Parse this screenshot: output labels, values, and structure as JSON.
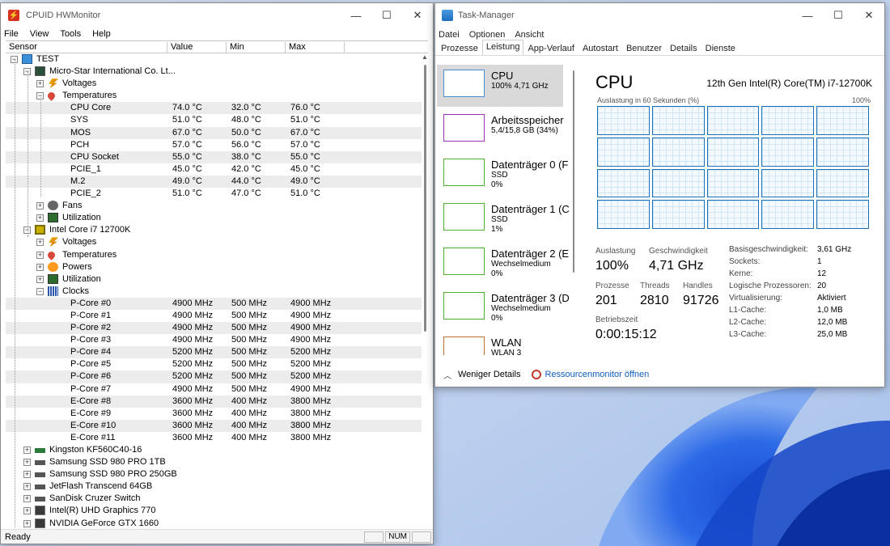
{
  "hwmonitor": {
    "title": "CPUID HWMonitor",
    "app_icon": "lightning-icon",
    "menu": [
      "File",
      "View",
      "Tools",
      "Help"
    ],
    "columns": [
      "Sensor",
      "Value",
      "Min",
      "Max"
    ],
    "tree": [
      {
        "label": "TEST",
        "level": 0,
        "icon": "pc",
        "exp": "-"
      },
      {
        "label": "Micro-Star International Co. Lt...",
        "level": 1,
        "icon": "mb",
        "exp": "-"
      },
      {
        "label": "Voltages",
        "level": 2,
        "icon": "volt",
        "exp": "+"
      },
      {
        "label": "Temperatures",
        "level": 2,
        "icon": "temp",
        "exp": "-"
      },
      {
        "label": "CPU Core",
        "level": 3,
        "value": "74.0 °C",
        "min": "32.0 °C",
        "max": "76.0 °C"
      },
      {
        "label": "SYS",
        "level": 3,
        "value": "51.0 °C",
        "min": "48.0 °C",
        "max": "51.0 °C"
      },
      {
        "label": "MOS",
        "level": 3,
        "value": "67.0 °C",
        "min": "50.0 °C",
        "max": "67.0 °C"
      },
      {
        "label": "PCH",
        "level": 3,
        "value": "57.0 °C",
        "min": "56.0 °C",
        "max": "57.0 °C"
      },
      {
        "label": "CPU Socket",
        "level": 3,
        "value": "55.0 °C",
        "min": "38.0 °C",
        "max": "55.0 °C"
      },
      {
        "label": "PCIE_1",
        "level": 3,
        "value": "45.0 °C",
        "min": "42.0 °C",
        "max": "45.0 °C"
      },
      {
        "label": "M.2",
        "level": 3,
        "value": "49.0 °C",
        "min": "44.0 °C",
        "max": "49.0 °C"
      },
      {
        "label": "PCIE_2",
        "level": 3,
        "value": "51.0 °C",
        "min": "47.0 °C",
        "max": "51.0 °C"
      },
      {
        "label": "Fans",
        "level": 2,
        "icon": "fan",
        "exp": "+"
      },
      {
        "label": "Utilization",
        "level": 2,
        "icon": "util",
        "exp": "+"
      },
      {
        "label": "Intel Core i7 12700K",
        "level": 1,
        "icon": "cpu",
        "exp": "-"
      },
      {
        "label": "Voltages",
        "level": 2,
        "icon": "volt",
        "exp": "+"
      },
      {
        "label": "Temperatures",
        "level": 2,
        "icon": "temp",
        "exp": "+"
      },
      {
        "label": "Powers",
        "level": 2,
        "icon": "power",
        "exp": "+"
      },
      {
        "label": "Utilization",
        "level": 2,
        "icon": "util",
        "exp": "+"
      },
      {
        "label": "Clocks",
        "level": 2,
        "icon": "clock",
        "exp": "-"
      },
      {
        "label": "P-Core #0",
        "level": 3,
        "value": "4900 MHz",
        "min": "500 MHz",
        "max": "4900 MHz"
      },
      {
        "label": "P-Core #1",
        "level": 3,
        "value": "4900 MHz",
        "min": "500 MHz",
        "max": "4900 MHz"
      },
      {
        "label": "P-Core #2",
        "level": 3,
        "value": "4900 MHz",
        "min": "500 MHz",
        "max": "4900 MHz"
      },
      {
        "label": "P-Core #3",
        "level": 3,
        "value": "4900 MHz",
        "min": "500 MHz",
        "max": "4900 MHz"
      },
      {
        "label": "P-Core #4",
        "level": 3,
        "value": "5200 MHz",
        "min": "500 MHz",
        "max": "5200 MHz"
      },
      {
        "label": "P-Core #5",
        "level": 3,
        "value": "5200 MHz",
        "min": "500 MHz",
        "max": "5200 MHz"
      },
      {
        "label": "P-Core #6",
        "level": 3,
        "value": "5200 MHz",
        "min": "500 MHz",
        "max": "5200 MHz"
      },
      {
        "label": "P-Core #7",
        "level": 3,
        "value": "4900 MHz",
        "min": "500 MHz",
        "max": "4900 MHz"
      },
      {
        "label": "E-Core #8",
        "level": 3,
        "value": "3600 MHz",
        "min": "400 MHz",
        "max": "3800 MHz"
      },
      {
        "label": "E-Core #9",
        "level": 3,
        "value": "3600 MHz",
        "min": "400 MHz",
        "max": "3800 MHz"
      },
      {
        "label": "E-Core #10",
        "level": 3,
        "value": "3600 MHz",
        "min": "400 MHz",
        "max": "3800 MHz"
      },
      {
        "label": "E-Core #11",
        "level": 3,
        "value": "3600 MHz",
        "min": "400 MHz",
        "max": "3800 MHz"
      },
      {
        "label": "Kingston KF560C40-16",
        "level": 1,
        "icon": "ram",
        "exp": "+"
      },
      {
        "label": "Samsung SSD 980 PRO 1TB",
        "level": 1,
        "icon": "disk",
        "exp": "+"
      },
      {
        "label": "Samsung SSD 980 PRO 250GB",
        "level": 1,
        "icon": "disk",
        "exp": "+"
      },
      {
        "label": "JetFlash Transcend 64GB",
        "level": 1,
        "icon": "disk",
        "exp": "+"
      },
      {
        "label": "SanDisk Cruzer Switch",
        "level": 1,
        "icon": "disk",
        "exp": "+"
      },
      {
        "label": "Intel(R) UHD Graphics 770",
        "level": 1,
        "icon": "gpu",
        "exp": "+"
      },
      {
        "label": "NVIDIA GeForce GTX 1660",
        "level": 1,
        "icon": "gpu",
        "exp": "+"
      }
    ],
    "status": {
      "ready": "Ready",
      "num": "NUM"
    }
  },
  "taskmanager": {
    "title": "Task-Manager",
    "menu": [
      "Datei",
      "Optionen",
      "Ansicht"
    ],
    "tabs": [
      "Prozesse",
      "Leistung",
      "App-Verlauf",
      "Autostart",
      "Benutzer",
      "Details",
      "Dienste"
    ],
    "active_tab": "Leistung",
    "sidebar": [
      {
        "name": "CPU",
        "sub1": "100% 4,71 GHz",
        "sub2": "",
        "color": "#4b8dd3",
        "selected": true
      },
      {
        "name": "Arbeitsspeicher",
        "sub1": "5,4/15,8 GB (34%)",
        "sub2": "",
        "color": "#9b30b8",
        "selected": false
      },
      {
        "name": "Datenträger 0 (F",
        "sub1": "SSD",
        "sub2": "0%",
        "color": "#4caf2f",
        "selected": false
      },
      {
        "name": "Datenträger 1 (C",
        "sub1": "SSD",
        "sub2": "1%",
        "color": "#4caf2f",
        "selected": false
      },
      {
        "name": "Datenträger 2 (E",
        "sub1": "Wechselmedium",
        "sub2": "0%",
        "color": "#4caf2f",
        "selected": false
      },
      {
        "name": "Datenträger 3 (D",
        "sub1": "Wechselmedium",
        "sub2": "0%",
        "color": "#4caf2f",
        "selected": false
      },
      {
        "name": "WLAN",
        "sub1": "WLAN 3",
        "sub2": "",
        "color": "#b87333",
        "selected": false
      }
    ],
    "cpu": {
      "heading": "CPU",
      "model": "12th Gen Intel(R) Core(TM) i7-12700K",
      "graph_label": "Auslastung in 60 Sekunden (%)",
      "graph_max": "100%",
      "graph_cells": 20,
      "stats": {
        "auslastung_label": "Auslastung",
        "auslastung": "100%",
        "geschw_label": "Geschwindigkeit",
        "geschw": "4,71 GHz",
        "prozesse_label": "Prozesse",
        "prozesse": "201",
        "threads_label": "Threads",
        "threads": "2810",
        "handles_label": "Handles",
        "handles": "91726",
        "betrieb_label": "Betriebszeit",
        "betrieb": "0:00:15:12"
      },
      "details": [
        {
          "k": "Basisgeschwindigkeit:",
          "v": "3,61 GHz"
        },
        {
          "k": "Sockets:",
          "v": "1"
        },
        {
          "k": "Kerne:",
          "v": "12"
        },
        {
          "k": "Logische Prozessoren:",
          "v": "20"
        },
        {
          "k": "Virtualisierung:",
          "v": "Aktiviert"
        },
        {
          "k": "L1-Cache:",
          "v": "1,0 MB"
        },
        {
          "k": "L2-Cache:",
          "v": "12,0 MB"
        },
        {
          "k": "L3-Cache:",
          "v": "25,0 MB"
        }
      ]
    },
    "footer": {
      "less": "Weniger Details",
      "link": "Ressourcenmonitor öffnen"
    }
  }
}
